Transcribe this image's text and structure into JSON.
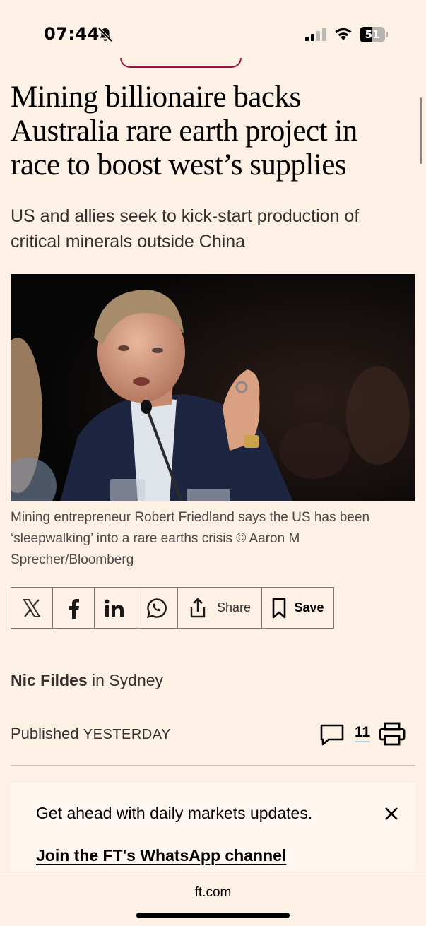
{
  "status_bar": {
    "time": "07:44",
    "battery": "51",
    "battery_level": 0.51
  },
  "article": {
    "headline": "Mining billionaire backs Australia rare earth project in race to boost west’s supplies",
    "standfirst": "US and allies seek to kick-start production of critical minerals outside China",
    "image_caption": "Mining entrepreneur Robert Friedland says the US has been ‘sleepwalking’ into a rare earths crisis © Aaron M Sprecher/Bloomberg",
    "author": "Nic Fildes",
    "location_prefix": "in",
    "location": "Sydney",
    "published_label": "Published",
    "published_date": "YESTERDAY",
    "comment_count": "11"
  },
  "share_bar": {
    "share_label": "Share",
    "save_label": "Save",
    "icons": [
      "x-icon",
      "facebook-icon",
      "linkedin-icon",
      "whatsapp-icon",
      "share-icon",
      "bookmark-icon"
    ]
  },
  "promo": {
    "text": "Get ahead with daily markets updates.",
    "link": "Join the FT's WhatsApp channel"
  },
  "browser": {
    "url": "ft.com"
  },
  "colors": {
    "background": "#fdf1e6",
    "accent": "#990f3d",
    "text": "#33302e"
  }
}
